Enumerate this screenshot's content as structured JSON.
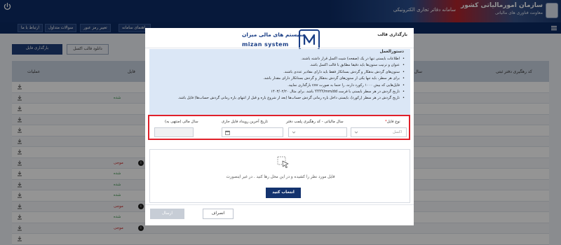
{
  "header": {
    "org_title": "سازمان امورمالیاتی کشور",
    "org_subtitle": "معاونت فناوری های مالیاتی",
    "system_title": "سامانه دفاتر تجاری الکترونیکی"
  },
  "navbar": {
    "items": [
      "ارتباط با ما",
      "سوالات متداول",
      "تغییر رمز عبور",
      "راهنمای سامانه"
    ]
  },
  "tabs": {
    "download_template": "دانلود قالب اکسل",
    "upload_file": "بارگذاری فایل"
  },
  "bg_table": {
    "headers": [
      "عملیات",
      "فایل",
      "سال مالی",
      "کد رهگیری دفتر ثبتی"
    ],
    "status_labels": [
      "شده",
      "موجی"
    ]
  },
  "modal": {
    "title": "بارگذاری قالب",
    "brand_fa": "سیستم های مالی میزان",
    "brand_en": "mizan system",
    "instructions_title": "دستورالعمل",
    "instructions": [
      "اطلاعات بایستی تنها در یک (صفحه) شیت اکسل قرار داشته باشند.",
      "عنوان و ترتیب ستون‌ها باید دقیقا مطابق با قالب اکسل باشد.",
      "ستون‌های گردش بدهکار و گردش بستانکار فقط باید دارای مقادیر عددی باشند.",
      "برای هر سطر، باید تنها یکی از ستون‌های گردش بدهکار و گردش بستانکار دارای مقدار باشد.",
      "فایل‌هایی که بیش ۱۰۰۰ رکورد دارند، را حتما به صورت csv بارگذاری نمایید.",
      "تاریخ گردش در هر سطر بایستی با فرمت YYYY/mm/dd باشد. برای مثال ۱۴۰۳/۰۲/۲۰",
      "تاریخ گردش در هر سطر (رکورد)، بایستی داخل بازه زمانی گردش حساب‌ها (بعد از شروع بازه و قبل از انتهای بازه زمانی گردش حساب‌ها) فایل باشد."
    ],
    "fields": {
      "file_type_label": "نوع فایل",
      "file_type_value": "اکسل",
      "fiscal_year_tracking_label": "سال مالیاتی - کد رهگیری پلمب دفتر",
      "last_event_date_label": "تاریخ آخرین رویداد فایل جاری",
      "fiscal_year_end_label": "سال مالی (منتهی به)"
    },
    "upload": {
      "hint": "فایل مورد نظر را کشیده و در این محل رها کنید . در غیر اینصورت",
      "choose_button": "انتخاب کنید"
    },
    "footer": {
      "cancel": "انصراف",
      "send": "ارسال"
    }
  },
  "colors": {
    "primary": "#14336e",
    "highlight": "#e0202a",
    "instruction_bg": "#dbe7f6"
  }
}
